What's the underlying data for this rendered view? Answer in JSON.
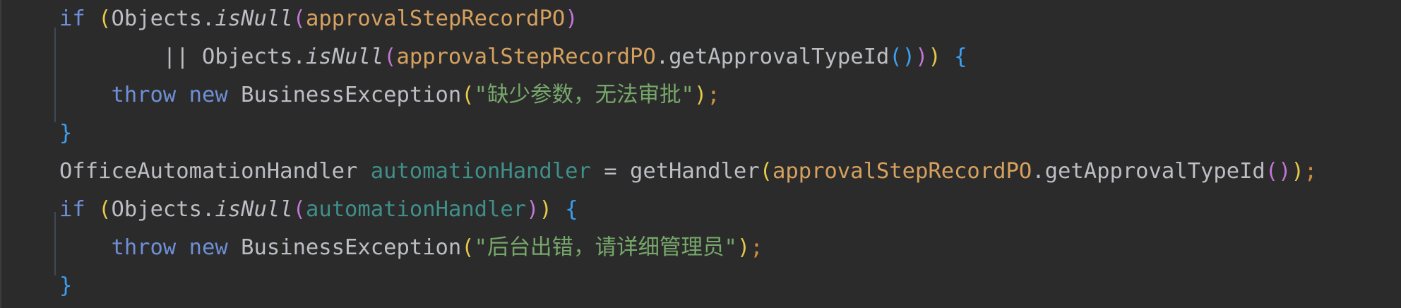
{
  "editor": {
    "language": "java",
    "lines": [
      {
        "indent": "",
        "tokens": [
          {
            "t": "if",
            "c": "kw"
          },
          {
            "t": " ",
            "c": "pun"
          },
          {
            "t": "(",
            "c": "p1"
          },
          {
            "t": "Objects",
            "c": "id"
          },
          {
            "t": ".",
            "c": "pun"
          },
          {
            "t": "isNull",
            "c": "it"
          },
          {
            "t": "(",
            "c": "p2"
          },
          {
            "t": "approvalStepRecordPO",
            "c": "var"
          },
          {
            "t": ")",
            "c": "p2"
          }
        ]
      },
      {
        "indent": "        ",
        "tokens": [
          {
            "t": "|| ",
            "c": "pun"
          },
          {
            "t": "Objects",
            "c": "id"
          },
          {
            "t": ".",
            "c": "pun"
          },
          {
            "t": "isNull",
            "c": "it"
          },
          {
            "t": "(",
            "c": "p2"
          },
          {
            "t": "approvalStepRecordPO",
            "c": "var"
          },
          {
            "t": ".",
            "c": "pun"
          },
          {
            "t": "getApprovalTypeId",
            "c": "id"
          },
          {
            "t": "()",
            "c": "p3"
          },
          {
            "t": ")",
            "c": "p2"
          },
          {
            "t": ")",
            "c": "p1"
          },
          {
            "t": " ",
            "c": "pun"
          },
          {
            "t": "{",
            "c": "br"
          }
        ]
      },
      {
        "indent": "    ",
        "tokens": [
          {
            "t": "throw",
            "c": "kw"
          },
          {
            "t": " ",
            "c": "pun"
          },
          {
            "t": "new",
            "c": "kw"
          },
          {
            "t": " BusinessException",
            "c": "id"
          },
          {
            "t": "(",
            "c": "p1"
          },
          {
            "t": "\"缺少参数，无法审批\"",
            "c": "str"
          },
          {
            "t": ")",
            "c": "p1"
          },
          {
            "t": ";",
            "c": "semi"
          }
        ]
      },
      {
        "indent": "",
        "tokens": [
          {
            "t": "}",
            "c": "br"
          }
        ]
      },
      {
        "indent": "",
        "tokens": [
          {
            "t": "OfficeAutomationHandler ",
            "c": "id"
          },
          {
            "t": "automationHandler",
            "c": "fld"
          },
          {
            "t": " = ",
            "c": "pun"
          },
          {
            "t": "getHandler",
            "c": "id"
          },
          {
            "t": "(",
            "c": "p1"
          },
          {
            "t": "approvalStepRecordPO",
            "c": "var"
          },
          {
            "t": ".",
            "c": "pun"
          },
          {
            "t": "getApprovalTypeId",
            "c": "id"
          },
          {
            "t": "()",
            "c": "p2"
          },
          {
            "t": ")",
            "c": "p1"
          },
          {
            "t": ";",
            "c": "semi"
          }
        ]
      },
      {
        "indent": "",
        "tokens": [
          {
            "t": "if",
            "c": "kw"
          },
          {
            "t": " ",
            "c": "pun"
          },
          {
            "t": "(",
            "c": "p1"
          },
          {
            "t": "Objects",
            "c": "id"
          },
          {
            "t": ".",
            "c": "pun"
          },
          {
            "t": "isNull",
            "c": "it"
          },
          {
            "t": "(",
            "c": "p2"
          },
          {
            "t": "automationHandler",
            "c": "fld"
          },
          {
            "t": ")",
            "c": "p2"
          },
          {
            "t": ")",
            "c": "p1"
          },
          {
            "t": " ",
            "c": "pun"
          },
          {
            "t": "{",
            "c": "br"
          }
        ]
      },
      {
        "indent": "    ",
        "tokens": [
          {
            "t": "throw",
            "c": "kw"
          },
          {
            "t": " ",
            "c": "pun"
          },
          {
            "t": "new",
            "c": "kw"
          },
          {
            "t": " BusinessException",
            "c": "id"
          },
          {
            "t": "(",
            "c": "p1"
          },
          {
            "t": "\"后台出错，请详细管理员\"",
            "c": "str"
          },
          {
            "t": ")",
            "c": "p1"
          },
          {
            "t": ";",
            "c": "semi"
          }
        ]
      },
      {
        "indent": "",
        "tokens": [
          {
            "t": "}",
            "c": "br"
          }
        ]
      }
    ]
  }
}
